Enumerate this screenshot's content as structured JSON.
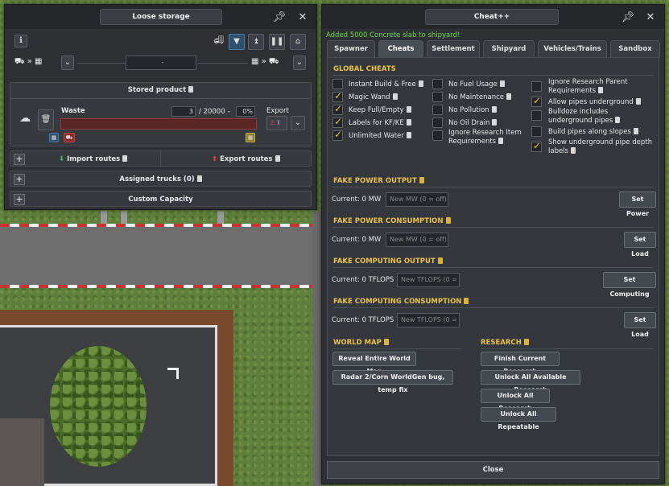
{
  "storage": {
    "title": "Loose storage",
    "route_value": "-",
    "stored_product_label": "Stored product",
    "product_name": "Waste",
    "quantity": "3",
    "capacity": "/ 20000",
    "separator": "-",
    "percent": "0%",
    "fill_fraction": 0.0,
    "export_label": "Export",
    "export_value": "I",
    "import_routes": "Import routes",
    "export_routes": "Export routes",
    "assigned_trucks": "Assigned trucks (0)",
    "custom_capacity": "Custom Capacity"
  },
  "cheat": {
    "title": "Cheat++",
    "message": "Added 5000 Concrete slab to shipyard!",
    "tabs": [
      "Spawner",
      "Cheats",
      "Settlement",
      "Shipyard",
      "Vehicles/Trains",
      "Sandbox"
    ],
    "active_tab": "Cheats",
    "global_header": "GLOBAL CHEATS",
    "col1": [
      {
        "label": "Instant Build & Free",
        "checked": false
      },
      {
        "label": "Magic Wand",
        "checked": true
      },
      {
        "label": "Keep Full/Empty",
        "checked": true
      },
      {
        "label": "Labels for KF/KE",
        "checked": true
      },
      {
        "label": "Unlimited Water",
        "checked": true
      }
    ],
    "col2": [
      {
        "label": "No Fuel Usage",
        "checked": false
      },
      {
        "label": "No Maintenance",
        "checked": false
      },
      {
        "label": "No Pollution",
        "checked": false
      },
      {
        "label": "No Oil Drain",
        "checked": false
      },
      {
        "label": "Ignore Research Item Requirements",
        "checked": false
      }
    ],
    "col3": [
      {
        "label": "Ignore Research Parent Requirements",
        "checked": false
      },
      {
        "label": "Allow pipes underground",
        "checked": true
      },
      {
        "label": "Bulldoze includes underground pipes",
        "checked": false
      },
      {
        "label": "Build pipes along slopes",
        "checked": false
      },
      {
        "label": "Show underground pipe depth labels",
        "checked": true
      }
    ],
    "power_output": {
      "header": "FAKE POWER OUTPUT",
      "current": "Current: 0 MW",
      "placeholder": "New MW (0 = off)..",
      "button": "Set Power"
    },
    "power_consumption": {
      "header": "FAKE POWER CONSUMPTION",
      "current": "Current: 0 MW",
      "placeholder": "New MW (0 = off)..",
      "button": "Set Load"
    },
    "computing_output": {
      "header": "FAKE COMPUTING OUTPUT",
      "current": "Current: 0 TFLOPS",
      "placeholder": "New TFLOPS (0 = off)..",
      "button": "Set Computing"
    },
    "computing_consumption": {
      "header": "FAKE COMPUTING CONSUMPTION",
      "current": "Current: 0 TFLOPS",
      "placeholder": "New TFLOPS (0 = off)..",
      "button": "Set Load"
    },
    "world_map": {
      "header": "WORLD MAP",
      "buttons": [
        "Reveal Entire World Map",
        "Radar 2/Corn WorldGen bug, temp fix"
      ]
    },
    "research": {
      "header": "RESEARCH",
      "buttons": [
        "Finish Current Research",
        "Unlock All Available Research",
        "Unlock All Research",
        "Unlock All Repeatable"
      ]
    },
    "close": "Close"
  },
  "colors": {
    "accent": "#e8c24a",
    "message": "#6fd64a",
    "check": "#f1c232"
  }
}
